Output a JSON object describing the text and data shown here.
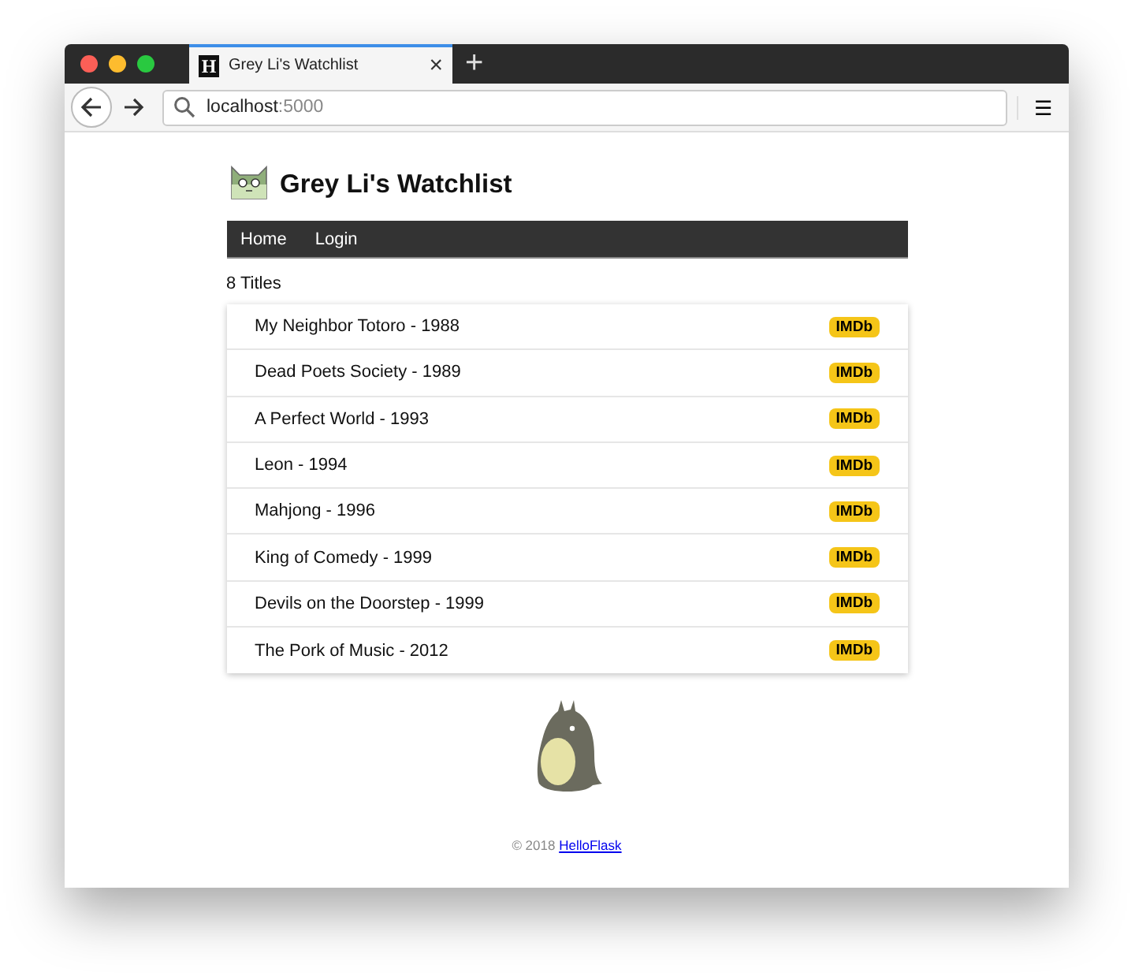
{
  "browser": {
    "tab": {
      "favicon": "H",
      "title": "Grey Li's Watchlist",
      "selected": true
    },
    "new_tab": "+",
    "close": "×",
    "address": {
      "host": "localhost",
      "port": ":5000"
    },
    "menu": "☰"
  },
  "page": {
    "title": "Grey Li's Watchlist",
    "nav": [
      {
        "label": "Home"
      },
      {
        "label": "Login"
      }
    ],
    "count": "8 Titles",
    "movies": [
      {
        "title": "My Neighbor Totoro - 1988",
        "badge": "IMDb"
      },
      {
        "title": "Dead Poets Society - 1989",
        "badge": "IMDb"
      },
      {
        "title": "A Perfect World - 1993",
        "badge": "IMDb"
      },
      {
        "title": "Leon - 1994",
        "badge": "IMDb"
      },
      {
        "title": "Mahjong - 1996",
        "badge": "IMDb"
      },
      {
        "title": "King of Comedy - 1999",
        "badge": "IMDb"
      },
      {
        "title": "Devils on the Doorstep - 1999",
        "badge": "IMDb"
      },
      {
        "title": "The Pork of Music - 2012",
        "badge": "IMDb"
      }
    ],
    "footer": {
      "copyright": "© 2018",
      "link": "HelloFlask"
    }
  }
}
